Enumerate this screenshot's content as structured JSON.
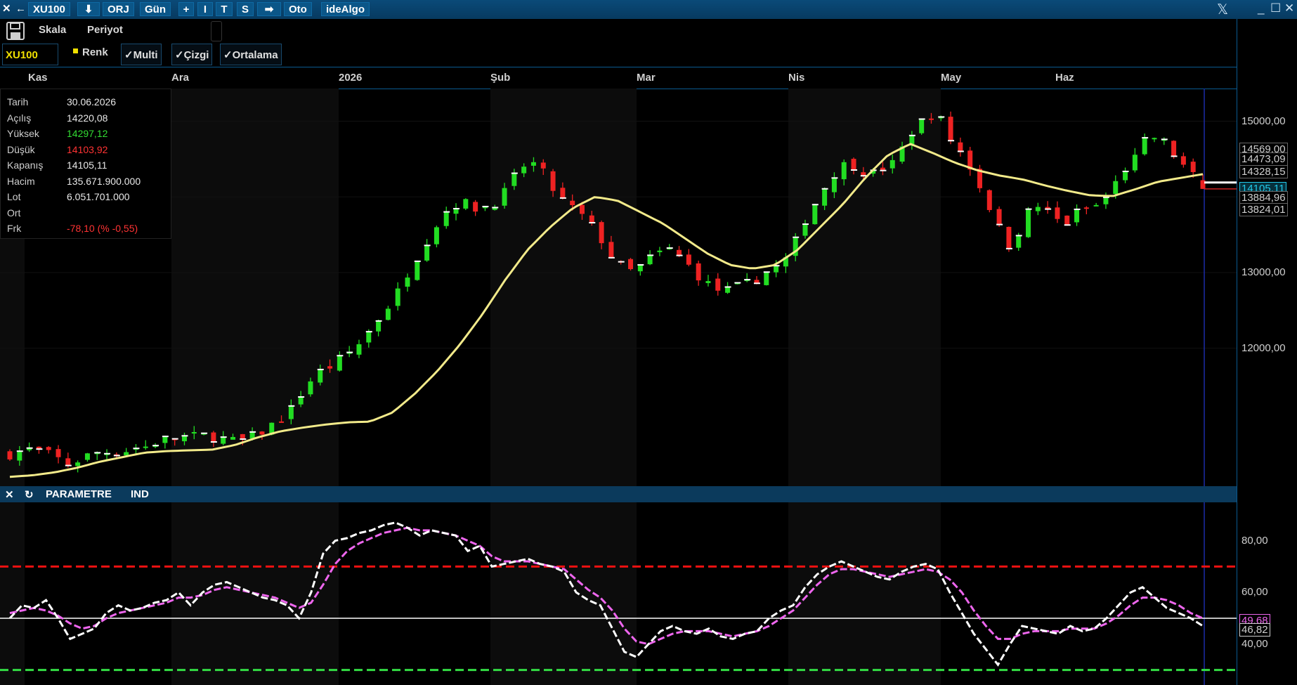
{
  "toolbar": {
    "symbol": "XU100",
    "orj": "ORJ",
    "period": "Gün",
    "plus": "+",
    "i": "I",
    "t": "T",
    "s": "S",
    "oto": "Oto",
    "idealgo": "ideAlgo",
    "skala": "Skala",
    "periyot": "Periyot",
    "symbol_tag": "XU100",
    "renk": "Renk",
    "multi": "✓Multi",
    "cizgi": "✓Çizgi",
    "ortalama": "✓Ortalama"
  },
  "months": [
    "Kas",
    "Ara",
    "2026",
    "Şub",
    "Mar",
    "Nis",
    "May",
    "Haz"
  ],
  "info": [
    {
      "k": "Tarih",
      "v": "30.06.2026",
      "color": "#e8e8e8"
    },
    {
      "k": "Açılış",
      "v": "14220,08",
      "color": "#e8e8e8"
    },
    {
      "k": "Yüksek",
      "v": "14297,12",
      "color": "#33dd33"
    },
    {
      "k": "Düşük",
      "v": "14103,92",
      "color": "#ff3333"
    },
    {
      "k": "Kapanış",
      "v": "14105,11",
      "color": "#e8e8e8"
    },
    {
      "k": "Hacim",
      "v": "135.671.900.000",
      "color": "#e8e8e8"
    },
    {
      "k": "Lot",
      "v": "6.051.701.000",
      "color": "#e8e8e8"
    },
    {
      "k": "Ort",
      "v": "",
      "color": "#e8e8e8"
    },
    {
      "k": "Frk",
      "v": "-78,10 (% -0,55)",
      "color": "#ff3333"
    }
  ],
  "indicator_bar": {
    "close": "✕",
    "refresh": "↻",
    "param": "PARAMETRE",
    "ind": "IND"
  },
  "price_axis": {
    "ticks": [
      "15000,00",
      "13000,00",
      "12000,00"
    ],
    "tags": [
      {
        "label": "14569,00",
        "value": 14569,
        "color": "#cfcfcf"
      },
      {
        "label": "14473,09",
        "value": 14473,
        "color": "#cfcfcf"
      },
      {
        "label": "14328,15",
        "value": 14328,
        "color": "#cfcfcf"
      },
      {
        "label": "14105,11",
        "value": 14105,
        "color": "#22c8e8"
      },
      {
        "label": "13884,96",
        "value": 13885,
        "color": "#cfcfcf"
      },
      {
        "label": "13824,01",
        "value": 13824,
        "color": "#cfcfcf"
      }
    ]
  },
  "ind_axis": {
    "ticks": [
      "80,00",
      "60,00",
      "40,00"
    ],
    "tags": [
      {
        "label": "49,68",
        "value": 49.68,
        "color": "#ee66ee"
      },
      {
        "label": "46,82",
        "value": 46.82,
        "color": "#cfcfcf"
      }
    ]
  },
  "colors": {
    "up": "#22dd22",
    "down": "#ee2222",
    "ma": "#f2ea8a",
    "stoch_k": "#ffffff",
    "stoch_d": "#ee66ee",
    "upper": "#ee1111",
    "lower": "#33dd44"
  },
  "chart_data": [
    {
      "type": "candlestick",
      "title": "XU100",
      "ylim": [
        10300,
        15500
      ],
      "months": [
        "Kas",
        "Ara",
        "2026",
        "Şub",
        "Mar",
        "Nis",
        "May",
        "Haz"
      ],
      "close_path": [
        10600,
        10640,
        10660,
        10620,
        10560,
        10460,
        10520,
        10590,
        10630,
        10620,
        10640,
        10680,
        10700,
        10760,
        10810,
        10820,
        10830,
        10840,
        10830,
        10790,
        10760,
        10800,
        10880,
        10980,
        11080,
        11220,
        11500,
        11660,
        11740,
        11840,
        11950,
        12100,
        12300,
        12500,
        12700,
        13000,
        13250,
        13500,
        13750,
        13900,
        13920,
        13850,
        13880,
        13950,
        14150,
        14400,
        14450,
        14300,
        14050,
        13900,
        13800,
        13650,
        13450,
        13200,
        13050,
        13000,
        13150,
        13250,
        13300,
        13200,
        13050,
        12900,
        12780,
        12750,
        12800,
        12850,
        12950,
        13050,
        13100,
        13350,
        13700,
        13950,
        14200,
        14400,
        14450,
        14350,
        14300,
        14400,
        14450,
        14800,
        14950,
        15100,
        15000,
        14700,
        14550,
        14250,
        13950,
        13600,
        13350,
        13600,
        13900,
        13850,
        13700,
        13650,
        13800,
        13850,
        13900,
        14100,
        14350,
        14500,
        14750,
        14800,
        14650,
        14450,
        14300,
        14105
      ],
      "ma_path": [
        10300,
        10320,
        10360,
        10420,
        10500,
        10560,
        10620,
        10640,
        10650,
        10660,
        10720,
        10820,
        10900,
        10950,
        10990,
        11020,
        11030,
        11150,
        11400,
        11700,
        12050,
        12450,
        12900,
        13300,
        13600,
        13850,
        14000,
        13950,
        13800,
        13650,
        13450,
        13250,
        13100,
        13050,
        13100,
        13300,
        13600,
        13900,
        14250,
        14550,
        14700,
        14580,
        14450,
        14350,
        14280,
        14230,
        14150,
        14080,
        14020,
        14010,
        14100,
        14200,
        14250,
        14300
      ],
      "last": {
        "date": "30.06.2026",
        "open": 14220.08,
        "high": 14297.12,
        "low": 14103.92,
        "close": 14105.11
      }
    },
    {
      "type": "line",
      "ylim": [
        20,
        100
      ],
      "levels": {
        "upper": 70,
        "middle": 50,
        "lower": 30
      },
      "series": [
        {
          "values": [
            50,
            55,
            54,
            57,
            50,
            42,
            44,
            46,
            52,
            55,
            53,
            54,
            56,
            57,
            60,
            55,
            60,
            63,
            64,
            62,
            60,
            58,
            57,
            55,
            50,
            60,
            75,
            80,
            81,
            83,
            84,
            86,
            87,
            85,
            82,
            84,
            83,
            82,
            76,
            78,
            70,
            71,
            72,
            73,
            71,
            70,
            68,
            60,
            57,
            55,
            46,
            37,
            35,
            40,
            45,
            47,
            45,
            44,
            46,
            43,
            42,
            44,
            45,
            50,
            53,
            55,
            62,
            67,
            70,
            72,
            70,
            68,
            66,
            65,
            68,
            70,
            71,
            69,
            60,
            52,
            44,
            38,
            32,
            40,
            47,
            46,
            45,
            44,
            47,
            45,
            46,
            50,
            55,
            60,
            62,
            58,
            54,
            52,
            50,
            47
          ]
        },
        {
          "values": [
            52,
            53,
            54,
            53,
            51,
            48,
            46,
            47,
            50,
            52,
            53,
            54,
            55,
            56,
            58,
            58,
            59,
            61,
            62,
            61,
            60,
            59,
            58,
            56,
            54,
            56,
            63,
            71,
            76,
            79,
            81,
            83,
            84,
            85,
            84,
            84,
            83,
            82,
            80,
            78,
            74,
            72,
            72,
            72,
            71,
            70,
            69,
            65,
            61,
            58,
            53,
            46,
            41,
            40,
            42,
            44,
            45,
            45,
            45,
            44,
            43,
            44,
            45,
            47,
            50,
            53,
            58,
            63,
            67,
            69,
            69,
            68,
            67,
            66,
            67,
            68,
            69,
            68,
            65,
            60,
            53,
            47,
            42,
            42,
            44,
            45,
            45,
            45,
            46,
            46,
            46,
            48,
            51,
            55,
            58,
            58,
            57,
            55,
            52,
            50
          ]
        }
      ]
    }
  ]
}
